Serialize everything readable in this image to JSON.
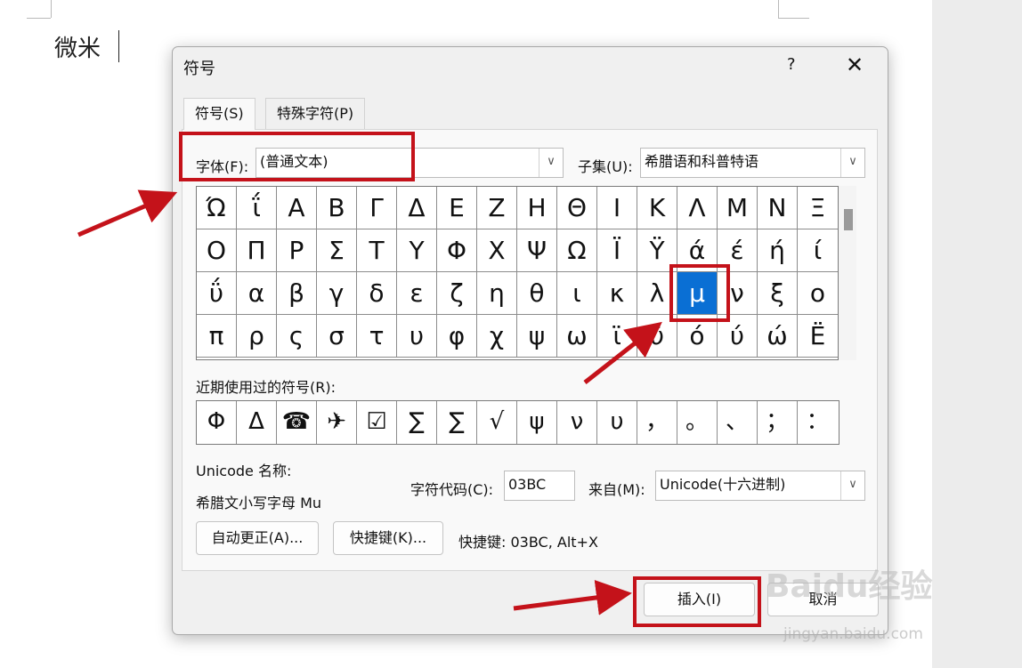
{
  "document": {
    "text": "微米"
  },
  "dialog": {
    "title": "符号",
    "help": "?",
    "close": "✕",
    "tabs": [
      "符号(S)",
      "特殊字符(P)"
    ],
    "font_label": "字体(F):",
    "font_value": "(普通文本)",
    "subset_label": "子集(U):",
    "subset_value": "希腊语和科普特语",
    "grid": [
      [
        "Ώ",
        "ΐ",
        "Α",
        "Β",
        "Γ",
        "Δ",
        "Ε",
        "Ζ",
        "Η",
        "Θ",
        "Ι",
        "Κ",
        "Λ",
        "Μ",
        "Ν",
        "Ξ"
      ],
      [
        "Ο",
        "Π",
        "Ρ",
        "Σ",
        "Τ",
        "Υ",
        "Φ",
        "Χ",
        "Ψ",
        "Ω",
        "Ϊ",
        "Ϋ",
        "ά",
        "έ",
        "ή",
        "ί"
      ],
      [
        "ΰ",
        "α",
        "β",
        "γ",
        "δ",
        "ε",
        "ζ",
        "η",
        "θ",
        "ι",
        "κ",
        "λ",
        "μ",
        "ν",
        "ξ",
        "ο"
      ],
      [
        "π",
        "ρ",
        "ς",
        "σ",
        "τ",
        "υ",
        "φ",
        "χ",
        "ψ",
        "ω",
        "ϊ",
        "ϋ",
        "ό",
        "ύ",
        "ώ",
        "Ё"
      ]
    ],
    "selected_symbol": "μ",
    "recent_label": "近期使用过的符号(R):",
    "recent": [
      "Φ",
      "Δ",
      "☎",
      "✈",
      "☑",
      "∑",
      "∑",
      "√",
      "ψ",
      "ν",
      "υ",
      "，",
      "。",
      "、",
      "；",
      "："
    ],
    "unicode_name_label": "Unicode 名称:",
    "unicode_name": "希腊文小写字母 Mu",
    "char_code_label": "字符代码(C):",
    "char_code": "03BC",
    "from_label": "来自(M):",
    "from_value": "Unicode(十六进制)",
    "autocorrect_button": "自动更正(A)...",
    "shortcut_button": "快捷键(K)...",
    "shortcut_text": "快捷键: 03BC, Alt+X",
    "insert_button": "插入(I)",
    "cancel_button": "取消"
  },
  "watermark": {
    "logo": "Baidu经验",
    "site": "jingyan.baidu.com"
  },
  "colors": {
    "selection": "#0a6fd4",
    "highlight": "#c4121a"
  }
}
